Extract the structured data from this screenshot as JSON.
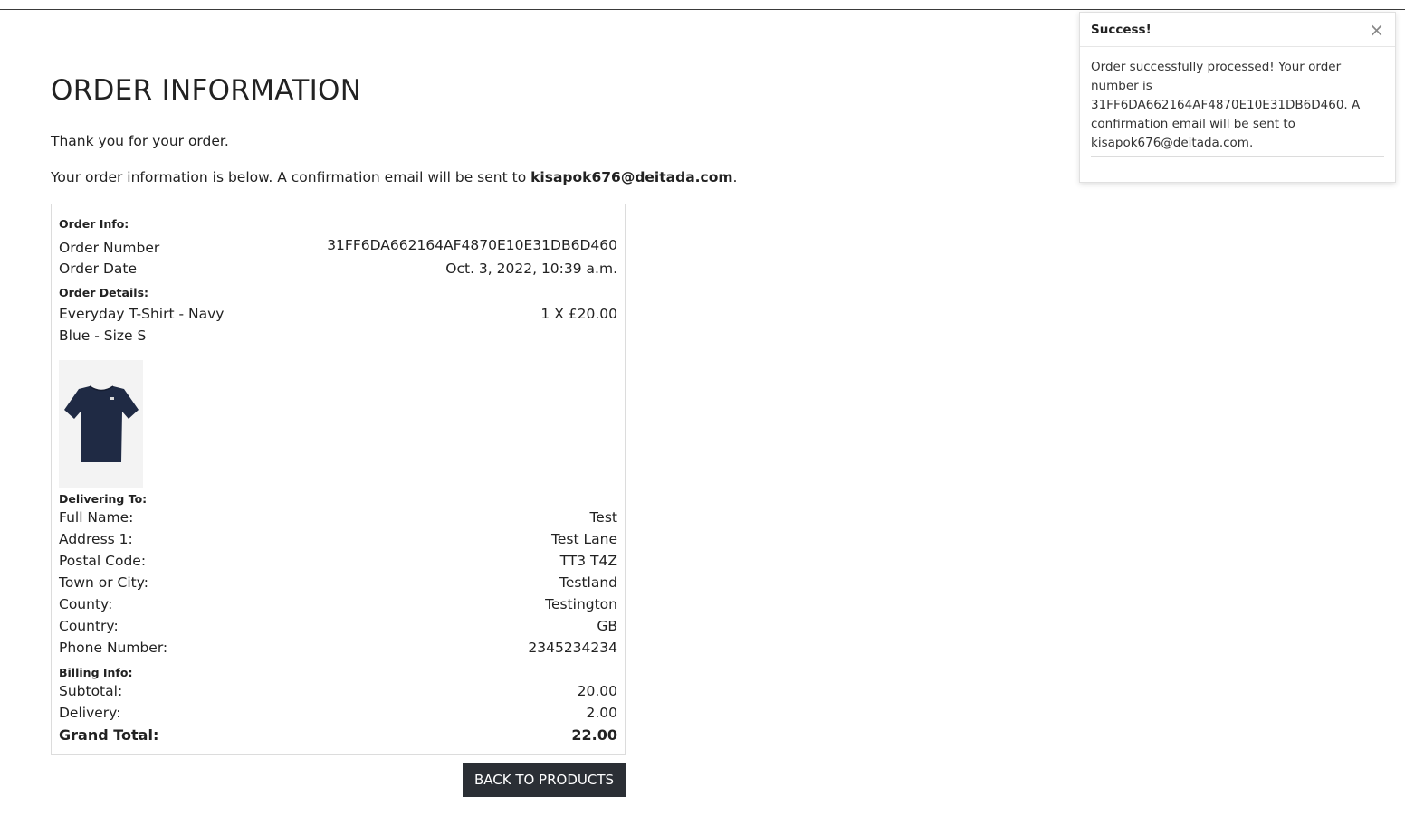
{
  "page": {
    "title": "ORDER INFORMATION",
    "thanks": "Thank you for your order.",
    "info_prefix": "Your order information is below. A confirmation email will be sent to ",
    "email": "kisapok676@deitada.com",
    "info_suffix": "."
  },
  "order_info": {
    "heading": "Order Info:",
    "number_label": "Order Number",
    "number": "31FF6DA662164AF4870E10E31DB6D460",
    "date_label": "Order Date",
    "date": "Oct. 3, 2022, 10:39 a.m."
  },
  "order_details": {
    "heading": "Order Details:",
    "items": [
      {
        "name": "Everyday T-Shirt - Navy Blue - Size S",
        "quantity_price": "1 X £20.00",
        "image": "navy-tshirt",
        "color": "#1f2a44"
      }
    ]
  },
  "delivering_to": {
    "heading": "Delivering To:",
    "fields": [
      {
        "label": "Full Name:",
        "value": "Test"
      },
      {
        "label": "Address 1:",
        "value": "Test Lane"
      },
      {
        "label": "Postal Code:",
        "value": "TT3 T4Z"
      },
      {
        "label": "Town or City:",
        "value": "Testland"
      },
      {
        "label": "County:",
        "value": "Testington"
      },
      {
        "label": "Country:",
        "value": "GB"
      },
      {
        "label": "Phone Number:",
        "value": "2345234234"
      }
    ]
  },
  "billing": {
    "heading": "Billing Info:",
    "subtotal_label": "Subtotal:",
    "subtotal": "20.00",
    "delivery_label": "Delivery:",
    "delivery": "2.00",
    "grand_total_label": "Grand Total:",
    "grand_total": "22.00"
  },
  "actions": {
    "back_label": "BACK TO PRODUCTS"
  },
  "toast": {
    "title": "Success!",
    "close_icon": "close-icon",
    "message": "Order successfully processed! Your order number is 31FF6DA662164AF4870E10E31DB6D460. A confirmation email will be sent to kisapok676@deitada.com."
  },
  "colors": {
    "button_bg": "#2b2f35",
    "button_text": "#ffffff",
    "border": "#dcdcdc"
  }
}
